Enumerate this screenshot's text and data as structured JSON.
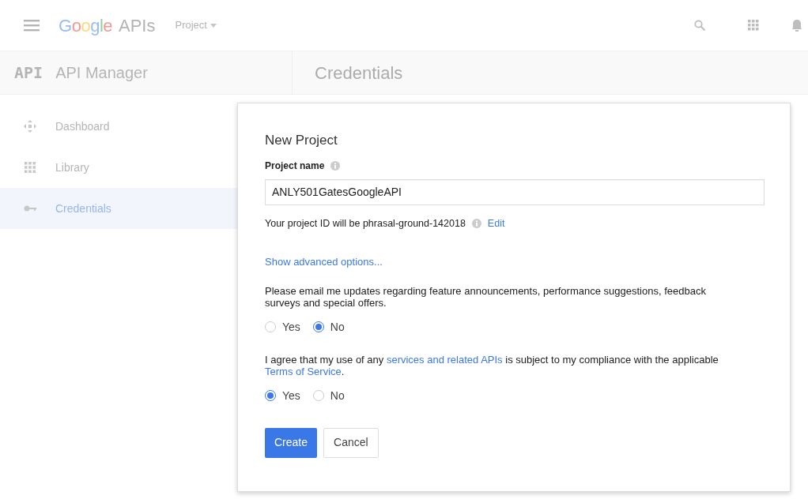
{
  "header": {
    "logo_google": "Google",
    "logo_apis": "APIs",
    "project_menu": "Project"
  },
  "subheader": {
    "logo": "API",
    "title": "API Manager",
    "page_title": "Credentials"
  },
  "sidebar": {
    "items": [
      {
        "label": "Dashboard",
        "kind": "dashboard",
        "selected": false
      },
      {
        "label": "Library",
        "kind": "library",
        "selected": false
      },
      {
        "label": "Credentials",
        "kind": "key",
        "selected": true
      }
    ]
  },
  "dialog": {
    "title": "New Project",
    "name_label": "Project name",
    "name_value": "ANLY501GatesGoogleAPI",
    "id_text": "Your project ID will be phrasal-ground-142018",
    "edit_link": "Edit",
    "advanced_link": "Show advanced options...",
    "questions": [
      {
        "parts": [
          {
            "text": "Please email me updates regarding feature announcements, performance suggestions, feedback surveys and special offers."
          }
        ],
        "options": [
          {
            "label": "Yes",
            "selected": false
          },
          {
            "label": "No",
            "selected": true
          }
        ]
      },
      {
        "parts": [
          {
            "text": "I agree that my use of any "
          },
          {
            "text": "services and related APIs",
            "kind": "link"
          },
          {
            "text": " is subject to my compliance with the applicable "
          },
          {
            "text": "Terms of Service",
            "kind": "link"
          },
          {
            "text": "."
          }
        ],
        "options": [
          {
            "label": "Yes",
            "selected": true
          },
          {
            "label": "No",
            "selected": false
          }
        ]
      }
    ],
    "buttons": [
      {
        "label": "Create",
        "kind": "primary"
      },
      {
        "label": "Cancel",
        "kind": "secondary"
      }
    ]
  }
}
